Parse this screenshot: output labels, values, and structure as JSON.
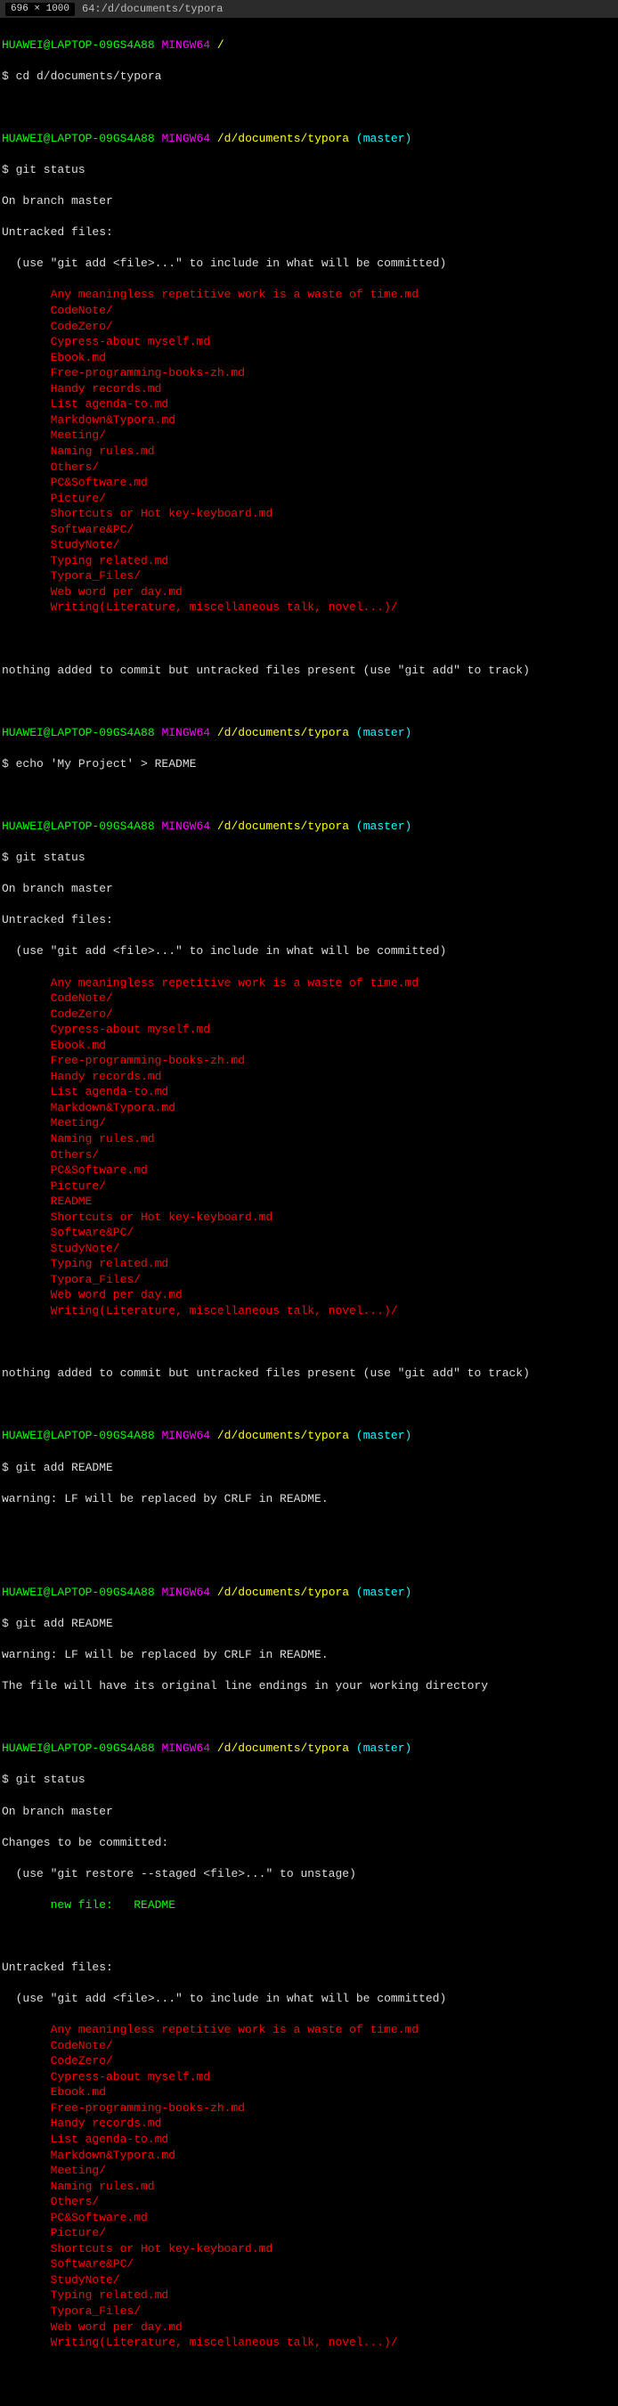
{
  "title_bar": {
    "badge": "696 × 1000",
    "path_suffix": "64:/d/documents/typora"
  },
  "prompt": {
    "user_host": "HUAWEI@LAPTOP-09GS4A88",
    "shell": "MINGW64",
    "path_root": "/",
    "path_typora": "/d/documents/typora",
    "branch": "(master)"
  },
  "cmds": {
    "cd": "$ cd d/documents/typora",
    "status": "$ git status",
    "echo": "$ echo 'My Project' > README",
    "add": "$ git add README"
  },
  "status": {
    "on_branch": "On branch master",
    "untracked_header": "Untracked files:",
    "untracked_hint": "  (use \"git add <file>...\" to include in what will be committed)",
    "nothing_added": "nothing added to commit but untracked files present (use \"git add\" to track)",
    "changes_header": "Changes to be committed:",
    "unstage_hint": "  (use \"git restore --staged <file>...\" to unstage)",
    "new_file_label": "new file:   ",
    "new_file_name": "README"
  },
  "warnings": {
    "crlf": "warning: LF will be replaced by CRLF in README.",
    "orig": "The file will have its original line endings in your working directory"
  },
  "files_a": [
    "Any meaningless repetitive work is a waste of time.md",
    "CodeNote/",
    "CodeZero/",
    "Cypress-about myself.md",
    "Ebook.md",
    "Free-programming-books-zh.md",
    "Handy records.md",
    "List agenda-to.md",
    "Markdown&Typora.md",
    "Meeting/",
    "Naming rules.md",
    "Others/",
    "PC&Software.md",
    "Picture/",
    "Shortcuts or Hot key-keyboard.md",
    "Software&PC/",
    "StudyNote/",
    "Typing related.md",
    "Typora_Files/",
    "Web word per day.md",
    "Writing(Literature, miscellaneous talk, novel...)/"
  ],
  "files_b": [
    "Any meaningless repetitive work is a waste of time.md",
    "CodeNote/",
    "CodeZero/",
    "Cypress-about myself.md",
    "Ebook.md",
    "Free-programming-books-zh.md",
    "Handy records.md",
    "List agenda-to.md",
    "Markdown&Typora.md",
    "Meeting/",
    "Naming rules.md",
    "Others/",
    "PC&Software.md",
    "Picture/",
    "README",
    "Shortcuts or Hot key-keyboard.md",
    "Software&PC/",
    "StudyNote/",
    "Typing related.md",
    "Typora_Files/",
    "Web word per day.md",
    "Writing(Literature, miscellaneous talk, novel...)/"
  ],
  "files_c": [
    "Any meaningless repetitive work is a waste of time.md",
    "CodeNote/",
    "CodeZero/",
    "Cypress-about myself.md",
    "Ebook.md",
    "Free-programming-books-zh.md",
    "Handy records.md",
    "List agenda-to.md",
    "Markdown&Typora.md",
    "Meeting/",
    "Naming rules.md",
    "Others/",
    "PC&Software.md",
    "Picture/",
    "Shortcuts or Hot key-keyboard.md",
    "Software&PC/",
    "StudyNote/",
    "Typing related.md",
    "Typora_Files/",
    "Web word per day.md",
    "Writing(Literature, miscellaneous talk, novel...)/"
  ]
}
